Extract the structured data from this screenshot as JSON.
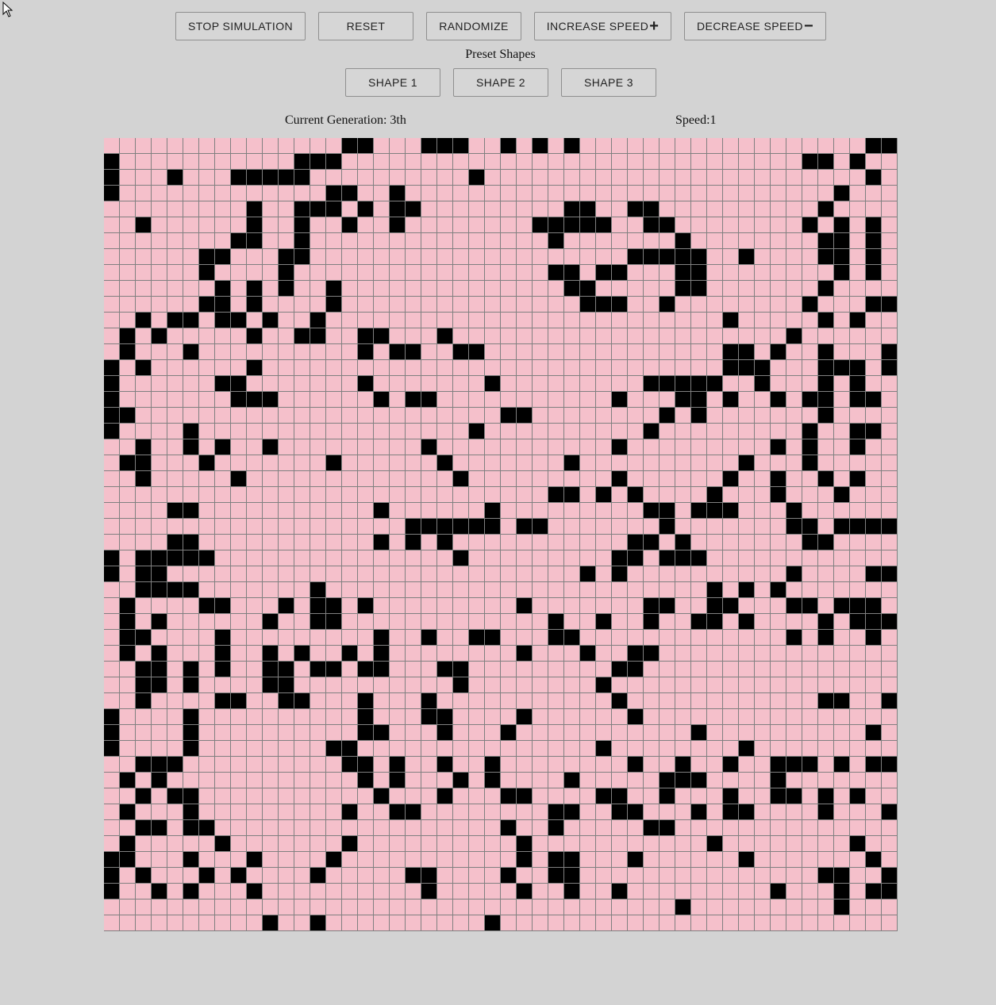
{
  "controls": {
    "stop_label": "STOP SIMULATION",
    "reset_label": "RESET",
    "randomize_label": "RANDOMIZE",
    "increase_label": "INCREASE SPEED",
    "increase_symbol": "+",
    "decrease_label": "DECREASE SPEED",
    "decrease_symbol": "−"
  },
  "presets": {
    "heading": "Preset Shapes",
    "shapes": [
      "SHAPE 1",
      "SHAPE 2",
      "SHAPE 3"
    ]
  },
  "status": {
    "generation": "Current Generation: 3th",
    "speed": "Speed:1"
  },
  "grid": {
    "columns": 50,
    "rows": 50,
    "alive_color": "#000000",
    "dead_color": "#f5c0cb",
    "line_color": "#808080",
    "alive_rows": [
      "...............##...###..#.#.#..................###...........",
      "#...........###.............................##.#..........####",
      "#...#...#####..........#........................#.##.......##.#",
      "#.............##..#...........................#............#..#",
      ".........#..###.#.##.........##..##..........#..........##.##.",
      "..#......#..#..#..#........#####..##........#.#.#.##......###.",
      "........##..#...............#.......#........##.#.....##..##..",
      "......##...##....................#####..#....##.#.............",
      "......#....#................##.##...##........#.#.##..........",
      ".......#.#.#..#..............##.....##.......#........#.........",
      "......##.#....#...............###..#........#...###........",
      "..#.##.##.#..#.........................#.....#.#......##.....",
      ".#.#.....#..##..##...#.....................#......#.....#..#.#",
      ".#...#..........#.##..##...............##.#..#...##.##....#.###",
      "#.#......#.............................###...###.##.#.#....#...",
      "#......##.......#.......#.........#####..#...#.#..######...#.##",
      "#.......###......#.##...........#...##.#..#.##.##..###..#.....",
      "##.......................##........#.#.......#......#...#.....",
      "#....#.................#..........#.........#..##.....##..##..",
      "..#..#.#..#.........#...........#.........#.#..#..#.....####..",
      ".##...#.......#......#.......#..........#...#......#.....#....",
      "..#.....#.............#.........#......#..#..#.#..........",
      "............................##.#.#....#...#...#.......#..",
      "....##...........#......#.........##.###...#.........##......",
      "...................######.##.......#.......##.####.....",
      "....##...........#.#.#...........##.#.......##..........",
      "#.#####...............#.........##.###.............#........",
      "#.##..........................#.#..........#....##.##....#....",
      "..####.......#........................#.#.#..........#.......",
      ".#....##...#.##.#.........#.......##..##...##.###.........",
      ".#.#......#..##.............#..#..#..##.#....#.###....",
      ".##....#.........#..#..##...##.............#.#..#...##.........",
      ".#.#...#..#.#..#.#........#...#..##...................#.",
      "..##.#.#..##.##.##...##.........##.................#.###",
      "..##.#....##..........#........#....................#..#",
      "..#....##..##...#...#...........#............##..#..#",
      "#....#..........#...##....#......#.................#.#",
      "#....#..........##...#...#...........#..........#...#",
      "#....#........##...............#........#...........###.",
      "..###..........##.#..#..#........#..#..#..###.#.##......#",
      ".#.#............#.#...#.#....#.....###....#...........#....",
      "..#.##...........#...#...##....##..#...#..##.#.#......#.#",
      ".#...#.........#..##........##..##...#.##....#...#.....#",
      "..##.##..................#..#.....##..................##.#",
      ".#.....#.......#..........#...........#........#......##.#",
      "##...#...#....#...........#.##...#......#.......#....##",
      "#.#...#.#....#.....##....#..##...............##..#",
      "#..#.#...#..........#.....#..#..#.........#...#.##",
      "....................................#.........#.......#",
      "..........#..#..........#...............................#"
    ]
  }
}
